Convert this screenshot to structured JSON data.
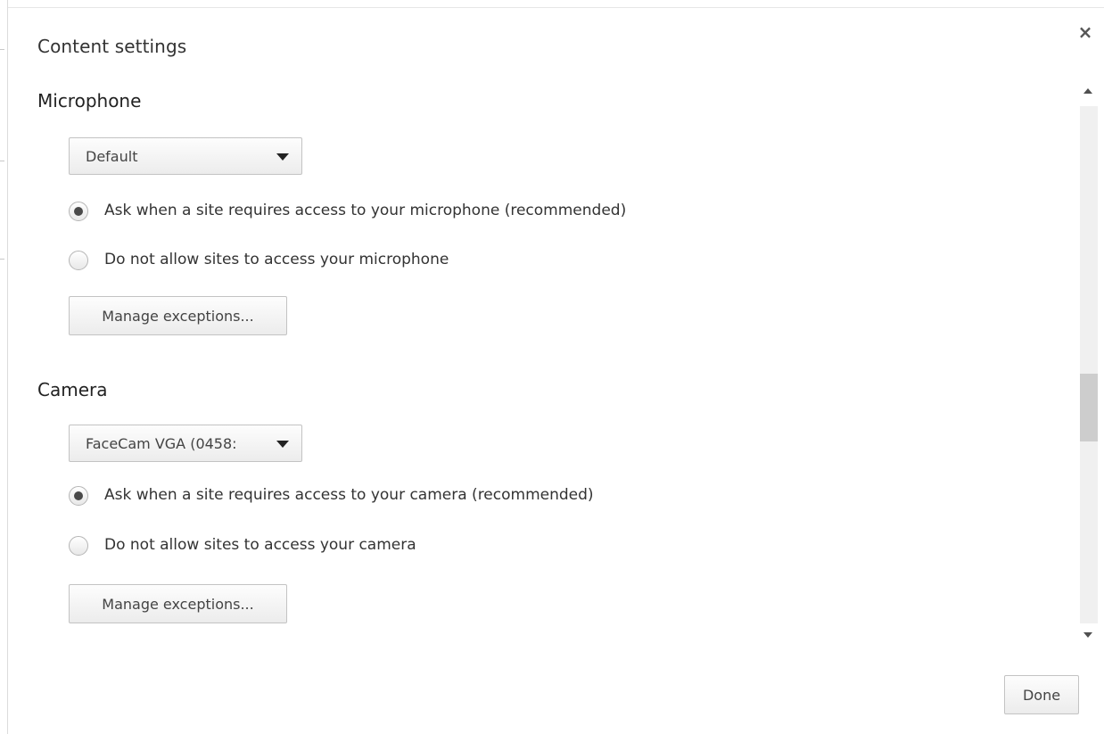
{
  "dialog": {
    "title": "Content settings",
    "close_glyph": "×",
    "done_label": "Done"
  },
  "microphone": {
    "heading": "Microphone",
    "device_selected": "Default",
    "options": [
      {
        "label": "Ask when a site requires access to your microphone (recommended)",
        "checked": true
      },
      {
        "label": "Do not allow sites to access your microphone",
        "checked": false
      }
    ],
    "manage_label": "Manage exceptions..."
  },
  "camera": {
    "heading": "Camera",
    "device_selected": "FaceCam VGA (0458:",
    "options": [
      {
        "label": "Ask when a site requires access to your camera (recommended)",
        "checked": true
      },
      {
        "label": "Do not allow sites to access your camera",
        "checked": false
      }
    ],
    "manage_label": "Manage exceptions..."
  },
  "icons": {
    "close": "close-icon",
    "dropdown": "chevron-down-icon",
    "scroll_up": "arrow-up-icon",
    "scroll_down": "arrow-down-icon"
  },
  "colors": {
    "text": "#333333",
    "button_border": "#c3c3c3",
    "radio_dot": "#4a4a4a",
    "scroll_thumb": "#cdcdcd"
  }
}
